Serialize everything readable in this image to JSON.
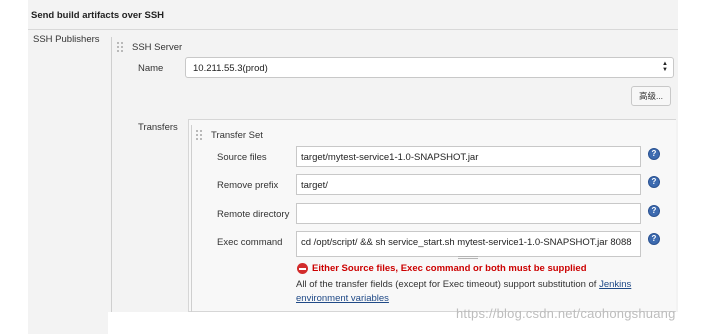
{
  "section": {
    "title": "Send build artifacts over SSH",
    "publishers_label": "SSH Publishers"
  },
  "ssh_server": {
    "title": "SSH Server",
    "name_label": "Name",
    "name_value": "10.211.55.3(prod)",
    "advanced_label": "高级..."
  },
  "transfers": {
    "label": "Transfers",
    "set_title": "Transfer Set",
    "source_files": {
      "label": "Source files",
      "value": "target/mytest-service1-1.0-SNAPSHOT.jar"
    },
    "remove_prefix": {
      "label": "Remove prefix",
      "value": "target/"
    },
    "remote_directory": {
      "label": "Remote directory",
      "value": ""
    },
    "exec_command": {
      "label": "Exec command",
      "value": "cd /opt/script/ && sh service_start.sh mytest-service1-1.0-SNAPSHOT.jar 8088"
    },
    "error": "Either Source files, Exec command or both must be supplied",
    "info_line1": "All of the transfer fields (except for Exec timeout) support substitution of",
    "info_link1": "Jenkins",
    "info_link2": "environment variables"
  },
  "help_glyph": "?",
  "select_arrows": "▲▼",
  "watermark": "https://blog.csdn.net/caohongshuang"
}
